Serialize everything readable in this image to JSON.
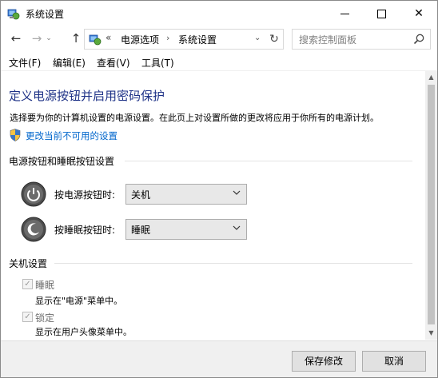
{
  "window": {
    "title": "系统设置",
    "controls": {
      "minimize": "minimize",
      "maximize": "maximize",
      "close": "✕"
    }
  },
  "nav": {
    "back": "←",
    "forward": "→",
    "recent": "⌄",
    "up": "↑",
    "address": {
      "separator": "«",
      "crumbs": [
        "电源选项",
        "系统设置"
      ],
      "arrow": "›",
      "dropdown": "⌄"
    },
    "refresh": "↻",
    "search_placeholder": "搜索控制面板"
  },
  "menu": {
    "items": [
      "文件(F)",
      "编辑(E)",
      "查看(V)",
      "工具(T)"
    ]
  },
  "page": {
    "title": "定义电源按钮并启用密码保护",
    "description": "选择要为你的计算机设置的电源设置。在此页上对设置所做的更改将应用于你所有的电源计划。",
    "change_link": "更改当前不可用的设置"
  },
  "power_section": {
    "header": "电源按钮和睡眠按钮设置",
    "power_button": {
      "label": "按电源按钮时:",
      "value": "关机"
    },
    "sleep_button": {
      "label": "按睡眠按钮时:",
      "value": "睡眠"
    }
  },
  "shutdown_section": {
    "header": "关机设置",
    "options": [
      {
        "label": "睡眠",
        "checked": true,
        "description": "显示在\"电源\"菜单中。"
      },
      {
        "label": "锁定",
        "checked": true,
        "description": "显示在用户头像菜单中。"
      }
    ]
  },
  "footer": {
    "save": "保存修改",
    "cancel": "取消"
  },
  "colors": {
    "title_blue": "#1e3287",
    "link_blue": "#0066cc",
    "disabled_gray": "#6d6d6d"
  },
  "icons": [
    "control-panel-icon",
    "shield-icon",
    "power-icon",
    "sleep-icon",
    "search-icon"
  ]
}
